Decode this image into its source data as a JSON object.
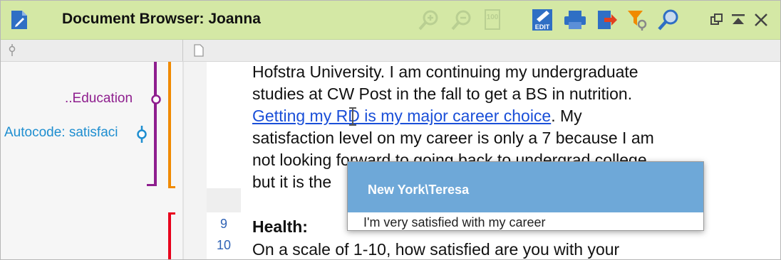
{
  "window": {
    "title": "Document Browser: Joanna"
  },
  "toolbar": {
    "icons": [
      "zoom-in-icon",
      "zoom-out-icon",
      "zoom-100-icon",
      "edit-icon",
      "print-icon",
      "export-icon",
      "filter-icon",
      "search-icon"
    ],
    "edit_label": "EDIT",
    "zoom100_label": "100"
  },
  "margin": {
    "codes": [
      {
        "label": "..Education",
        "color": "#8e1e8e"
      },
      {
        "label": "Autocode: satisfaci",
        "color": "#1e8ed0"
      }
    ],
    "bar_colors": [
      "#8e1e8e",
      "#f08a00",
      "#e8001c"
    ]
  },
  "line_numbers": [
    "9",
    "10"
  ],
  "document": {
    "lines": [
      "Hofstra University.  I am continuing my undergraduate",
      "studies at CW Post in the fall to get a BS in nutrition.",
      "satisfaction level on my career is only a 7 because I am",
      "not looking forward to going back to undergrad college",
      "but it is the"
    ],
    "link_text": "Getting my RD is my major career choice",
    "after_link": ".  My",
    "heading": "Health:",
    "question": "On a scale of 1-10, how satisfied are you with your"
  },
  "tooltip": {
    "title": "New York\\Teresa",
    "body": "I'm very satisfied with my career"
  }
}
